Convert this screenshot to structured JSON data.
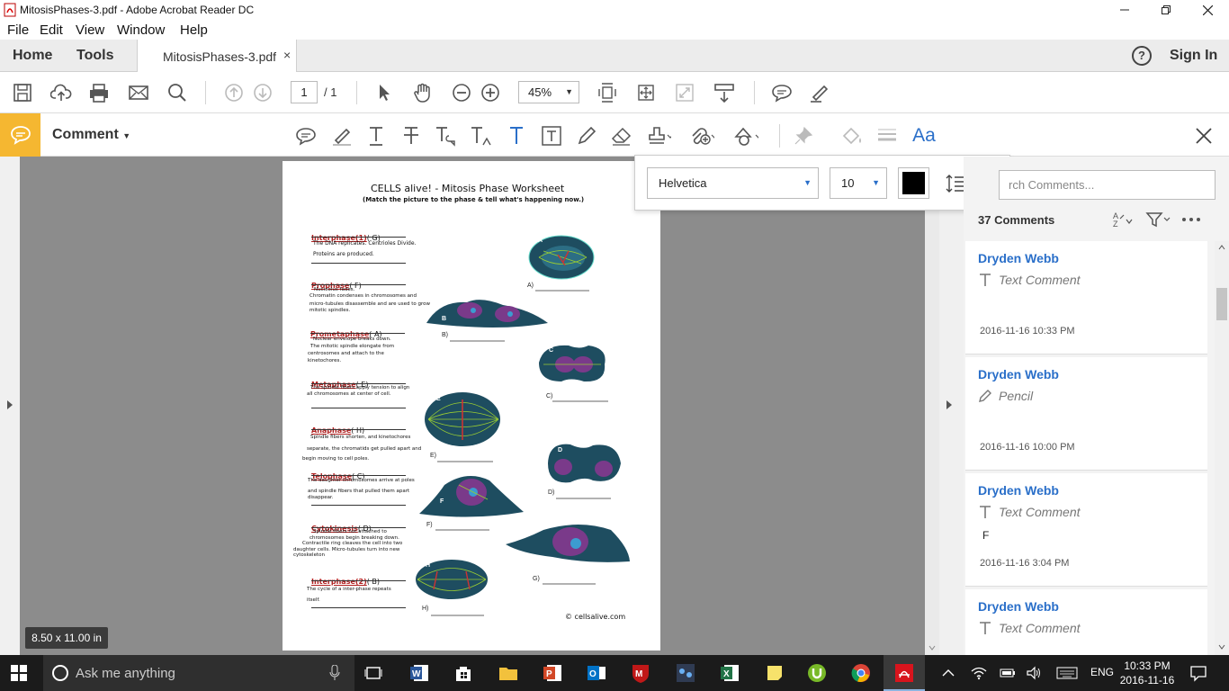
{
  "window": {
    "title": "MitosisPhases-3.pdf - Adobe Acrobat Reader DC"
  },
  "menu": {
    "file": "File",
    "edit": "Edit",
    "view": "View",
    "window": "Window",
    "help": "Help"
  },
  "tabs": {
    "home": "Home",
    "tools": "Tools",
    "document": "MitosisPhases-3.pdf",
    "close": "×",
    "signin": "Sign In",
    "help_icon": "?"
  },
  "toolbar": {
    "page_current": "1",
    "page_total": "/ 1",
    "zoom": "45%"
  },
  "comment_toolbar": {
    "label": "Comment"
  },
  "font_popup": {
    "font": "Helvetica",
    "size": "10",
    "color": "#000000"
  },
  "worksheet": {
    "title": "CELLS alive! - Mitosis Phase Worksheet",
    "subtitle": "(Match the picture to the phase & tell what's happening now.)",
    "phases": [
      {
        "name": "Interphase(1)",
        "answer": "( G)",
        "lines": [
          "The DNA replicates.  Centrioles Divide.",
          "Proteins are produced."
        ]
      },
      {
        "name": "Prophase",
        "answer": "( F)",
        "lines": [
          "Nucleolus fades.",
          "Chromatin condenses in chromosomes and",
          "micro-tubules disassemble and are used to grow",
          "mitotic spindles."
        ]
      },
      {
        "name": "Prometaphase",
        "answer": "( A)",
        "lines": [
          "Nuclear envelope breaks down.",
          "The mitotic spindle elongate from",
          "centrosomes and attach to the",
          "kinetochores."
        ]
      },
      {
        "name": "Metaphase",
        "answer": "( E)",
        "lines": [
          "The spindle fibers apply tension to align",
          "all chromosomes at center of cell."
        ]
      },
      {
        "name": "Anaphase",
        "answer": "( H)",
        "lines": [
          "Spindle fibers shorten, and kinetochores",
          "separate, the chromatids get pulled apart and",
          "begin moving to cell poles."
        ]
      },
      {
        "name": "Telophase",
        "answer": "( C)",
        "lines": [
          "The daughter chromosomes arrive at poles",
          "and spindle fibers that pulled them apart",
          "disappear."
        ]
      },
      {
        "name": "Cytokinesis",
        "answer": "( D)",
        "lines": [
          "Spindle fibers not attached to",
          "chromosomes begin breaking down.",
          "Contractile ring cleaves the cell into two",
          "daughter cells.  Micro-tubules turn into new",
          "cytoskeleton"
        ]
      },
      {
        "name": "Interphase(2)",
        "answer": "( B)",
        "lines": [
          "The cycle of a inter-phase repeats",
          "itself."
        ]
      }
    ],
    "picture_letters": [
      "A",
      "B",
      "C",
      "D",
      "E",
      "F",
      "G",
      "H"
    ],
    "picture_captions": [
      "A)",
      "B)",
      "C)",
      "D)",
      "E)",
      "F)",
      "G)",
      "H)"
    ],
    "copyright": "© cellsalive.com"
  },
  "page_size": "8.50 x 11.00 in",
  "comments_panel": {
    "search_placeholder": "rch Comments...",
    "count": "37 Comments",
    "items": [
      {
        "author": "Dryden Webb",
        "type": "Text Comment",
        "body": "",
        "date": "2016-11-16  10:33 PM"
      },
      {
        "author": "Dryden Webb",
        "type": "Pencil",
        "body": "",
        "date": "2016-11-16  10:00 PM"
      },
      {
        "author": "Dryden Webb",
        "type": "Text Comment",
        "body": "F",
        "date": "2016-11-16  3:04 PM"
      },
      {
        "author": "Dryden Webb",
        "type": "Text Comment",
        "body": "",
        "date": ""
      }
    ]
  },
  "taskbar": {
    "search": "Ask me anything",
    "lang": "ENG",
    "time": "10:33 PM",
    "date": "2016-11-16"
  }
}
